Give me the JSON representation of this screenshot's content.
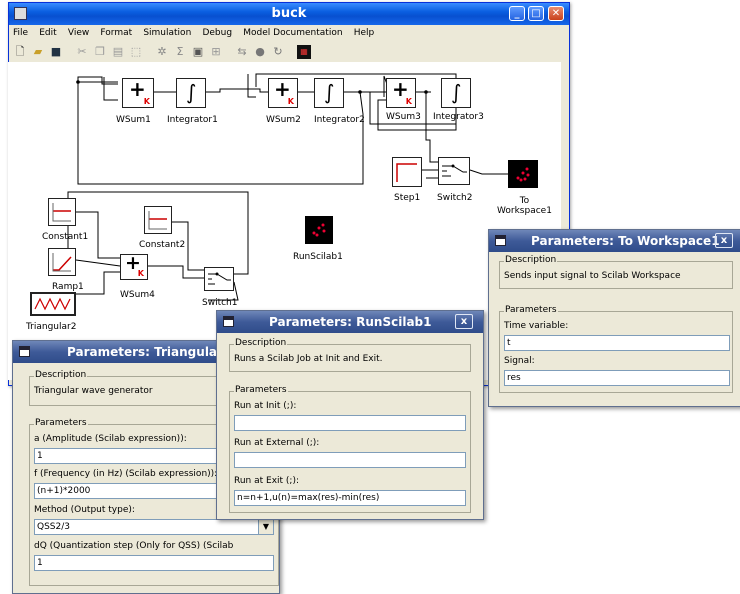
{
  "main_window": {
    "title": "buck",
    "menu": [
      "File",
      "Edit",
      "View",
      "Format",
      "Simulation",
      "Debug",
      "Model Documentation",
      "Help"
    ],
    "toolbar_icons": [
      "new-icon",
      "open-icon",
      "save-icon",
      "cut-icon",
      "copy-icon",
      "paste-icon",
      "select-icon",
      "compile-icon",
      "sum-icon",
      "component-icon",
      "diagram-icon",
      "run-icon",
      "record-icon",
      "stop-icon",
      "plot-icon"
    ]
  },
  "blocks": {
    "wsum1": "WSum1",
    "integrator1": "Integrator1",
    "wsum2": "WSum2",
    "integrator2": "Integrator2",
    "wsum3": "WSum3",
    "integrator3": "Integrator3",
    "step1": "Step1",
    "switch2": "Switch2",
    "to_workspace": "To\nWorkspace1",
    "constant1": "Constant1",
    "constant2": "Constant2",
    "ramp1": "Ramp1",
    "wsum4": "WSum4",
    "triangular2": "Triangular2",
    "runscilab1": "RunScilab1",
    "switch1": "Switch1",
    "sum_glyph": "+",
    "k_glyph": "K",
    "int_glyph": "∫"
  },
  "dlg_to_workspace": {
    "title": "Parameters: To Workspace1",
    "close": "x",
    "description_label": "Description",
    "description": "Sends input signal to Scilab Workspace",
    "parameters_label": "Parameters",
    "time_label": "Time variable:",
    "time_value": "t",
    "signal_label": "Signal:",
    "signal_value": "res"
  },
  "dlg_runscilab": {
    "title": "Parameters: RunScilab1",
    "close": "x",
    "description_label": "Description",
    "description": "Runs a Scilab Job at Init and Exit.",
    "parameters_label": "Parameters",
    "init_label": "Run at Init (;):",
    "init_value": "",
    "external_label": "Run at External (;):",
    "external_value": "",
    "exit_label": "Run at Exit (;):",
    "exit_value": "n=n+1,u(n)=max(res)-min(res)"
  },
  "dlg_triangular": {
    "title": "Parameters: Triangular",
    "description_label": "Description",
    "description": "Triangular wave generator",
    "parameters_label": "Parameters",
    "amp_label": "a (Amplitude (Scilab expression)):",
    "amp_value": "1",
    "freq_label": "f (Frequency (in Hz) (Scilab expression)):",
    "freq_value": "(n+1)*2000",
    "method_label": "Method (Output type):",
    "method_value": "QSS2/3",
    "dq_label": "dQ (Quantization step (Only for QSS) (Scilab",
    "dq_value": "1"
  }
}
